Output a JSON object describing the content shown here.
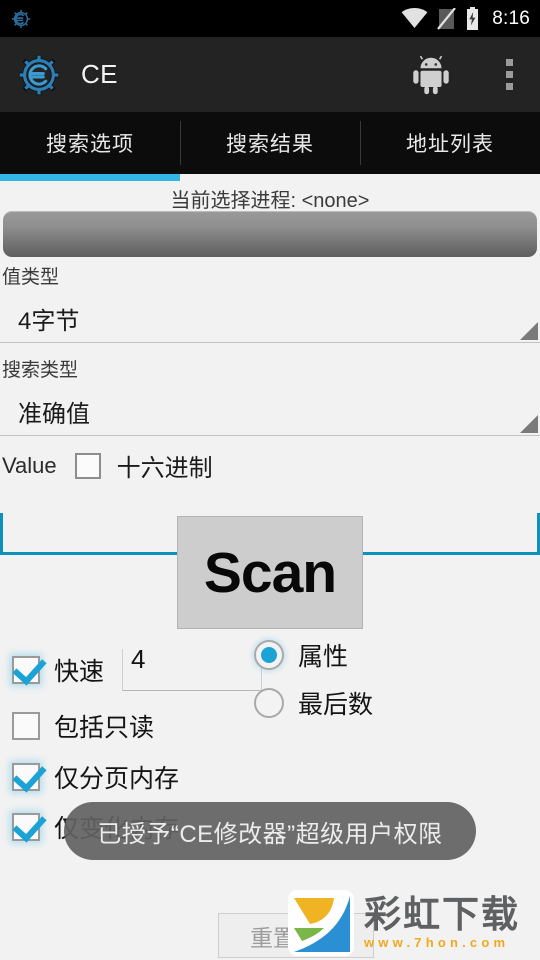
{
  "statusbar": {
    "notification_icon": "ce-gear-icon",
    "wifi_icon": "wifi-icon",
    "signal_icon": "no-sim-icon",
    "battery_icon": "battery-charging-icon",
    "clock": "8:16"
  },
  "actionbar": {
    "logo_icon": "ce-gear-logo",
    "title": "CE",
    "android_icon": "android-robot-icon",
    "overflow_icon": "overflow-menu-icon"
  },
  "tabs": [
    {
      "label": "搜索选项",
      "selected": true
    },
    {
      "label": "搜索结果",
      "selected": false
    },
    {
      "label": "地址列表",
      "selected": false
    }
  ],
  "process": {
    "label": "当前选择进程: <none>",
    "button_text": ""
  },
  "form": {
    "value_type_label": "值类型",
    "value_type_value": "4字节",
    "search_type_label": "搜索类型",
    "search_type_value": "准确值",
    "value_label": "Value",
    "hex_label": "十六进制",
    "hex_checked": false,
    "value_input": "",
    "value_input_placeholder": ""
  },
  "scan": {
    "label": "Scan"
  },
  "options": {
    "fast_label": "快速",
    "fast_checked": true,
    "fast_value": "4",
    "readonly_label": "包括只读",
    "readonly_checked": false,
    "paged_label": "仅分页内存",
    "paged_checked": true,
    "dirty_label": "仅变化内存",
    "dirty_checked": true
  },
  "radios": [
    {
      "label": "属性",
      "selected": true
    },
    {
      "label": "最后数",
      "selected": false
    }
  ],
  "reset": {
    "label": "重置扫描"
  },
  "toast": {
    "message": "已授予“CE修改器”超级用户权限"
  },
  "watermark": {
    "name": "彩虹下载",
    "url": "www.7hon.com"
  },
  "colors": {
    "accent": "#33b5e5",
    "accent_dark": "#0c92bd",
    "actionbar": "#232323",
    "tabbar": "#0c0c0c",
    "page_bg": "#f2f2f2",
    "scan_btn": "#cdcdcd",
    "toast_bg": "#626262"
  }
}
